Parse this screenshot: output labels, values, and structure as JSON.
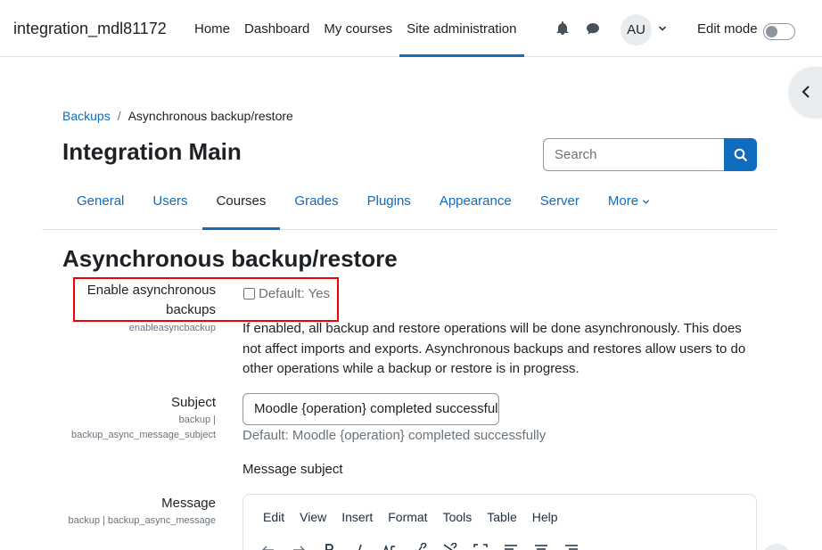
{
  "navbar": {
    "brand": "integration_mdl81172",
    "links": [
      {
        "label": "Home",
        "active": false
      },
      {
        "label": "Dashboard",
        "active": false
      },
      {
        "label": "My courses",
        "active": false
      },
      {
        "label": "Site administration",
        "active": true
      }
    ],
    "avatar_initials": "AU",
    "edit_mode_label": "Edit mode",
    "edit_mode_on": false
  },
  "breadcrumb": {
    "parent": "Backups",
    "separator": "/",
    "current": "Asynchronous backup/restore"
  },
  "page_header": "Integration Main",
  "search": {
    "placeholder": "Search"
  },
  "tabs": [
    {
      "label": "General",
      "active": false
    },
    {
      "label": "Users",
      "active": false
    },
    {
      "label": "Courses",
      "active": true
    },
    {
      "label": "Grades",
      "active": false
    },
    {
      "label": "Plugins",
      "active": false
    },
    {
      "label": "Appearance",
      "active": false
    },
    {
      "label": "Server",
      "active": false
    },
    {
      "label": "More",
      "active": false
    }
  ],
  "section_title": "Asynchronous backup/restore",
  "settings": {
    "async": {
      "label_line1": "Enable asynchronous",
      "label_line2": "backups",
      "key": "enableasyncbackup",
      "default": "Default: Yes",
      "checked": false,
      "description": "If enabled, all backup and restore operations will be done asynchronously. This does not affect imports and exports. Asynchronous backups and restores allow users to do other operations while a backup or restore is in progress."
    },
    "subject": {
      "label": "Subject",
      "key_line1": "backup |",
      "key_line2": "backup_async_message_subject",
      "value": "Moodle {operation} completed successfully",
      "default": "Default: Moodle {operation} completed successfully",
      "help": "Message subject"
    },
    "message": {
      "label": "Message",
      "key": "backup | backup_async_message"
    }
  },
  "editor": {
    "menu": [
      "Edit",
      "View",
      "Insert",
      "Format",
      "Tools",
      "Table",
      "Help"
    ]
  },
  "colors": {
    "primary": "#0f6cbf",
    "highlight": "#ee0000",
    "text": "#1d2125",
    "muted": "#6a737b"
  }
}
